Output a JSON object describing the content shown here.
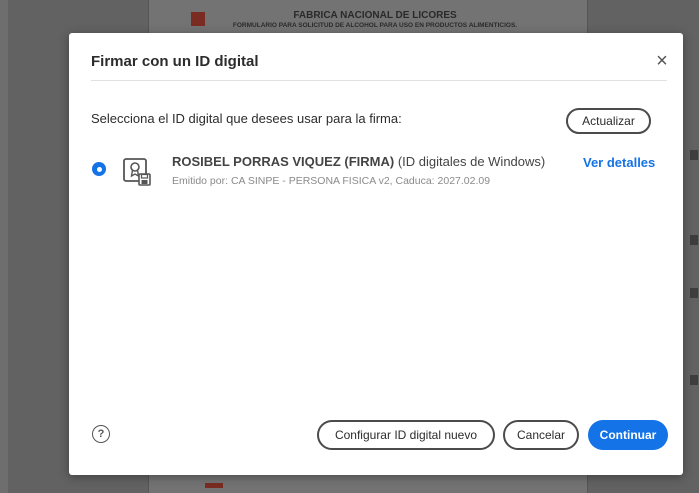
{
  "background": {
    "doc_title": "FABRICA NACIONAL DE LICORES",
    "doc_subtitle": "FORMULARIO PARA SOLICITUD DE ALCOHOL PARA USO EN PRODUCTOS ALIMENTICIOS."
  },
  "dialog": {
    "title": "Firmar con un ID digital",
    "close_glyph": "×",
    "instruction": "Selecciona el ID digital que desees usar para la firma:",
    "refresh_label": "Actualizar",
    "ids": [
      {
        "name": "ROSIBEL PORRAS VIQUEZ (FIRMA)",
        "source": "(ID digitales de Windows)",
        "meta": "Emitido por: CA SINPE - PERSONA FISICA v2, Caduca: 2027.02.09",
        "selected": true,
        "details_label": "Ver detalles",
        "icon": "certificate-icon"
      }
    ],
    "help_glyph": "?",
    "buttons": {
      "configure": "Configurar ID digital nuevo",
      "cancel": "Cancelar",
      "continue": "Continuar"
    }
  },
  "colors": {
    "accent": "#1473e6",
    "overlay": "#626262"
  }
}
